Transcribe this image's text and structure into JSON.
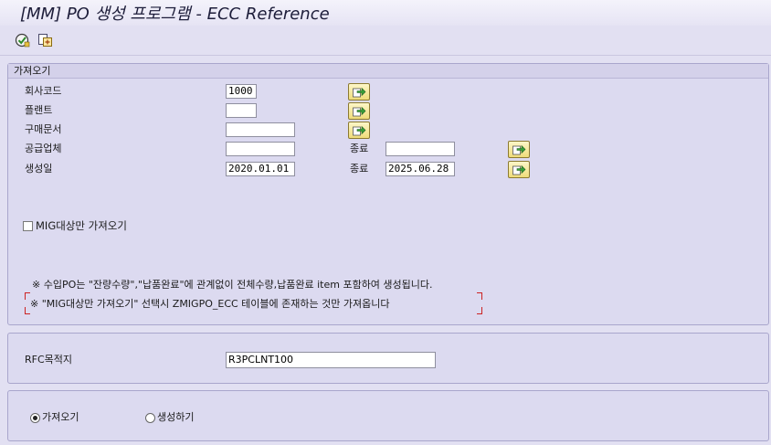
{
  "window": {
    "title": "[MM] PO 생성 프로그램 - ECC Reference"
  },
  "toolbar": {
    "execute_icon": "execute-icon",
    "variant_icon": "get-variant-icon"
  },
  "group_fetch": {
    "title": "가져오기",
    "rows": [
      {
        "label": "회사코드",
        "from_value": "1000"
      },
      {
        "label": "플랜트",
        "from_value": ""
      },
      {
        "label": "구매문서",
        "from_value": ""
      },
      {
        "label": "공급업체",
        "from_value": "",
        "to_label": "종료",
        "to_value": ""
      },
      {
        "label": "생성일",
        "from_value": "2020.01.01",
        "to_label": "종료",
        "to_value": "2025.06.28"
      }
    ],
    "mig_checkbox_label": "MIG대상만 가져오기",
    "mig_checked": false,
    "note_1": "※ 수입PO는 \"잔량수량\",\"납품완료\"에 관계없이 전체수량,납품완료 item 포함하여 생성됩니다.",
    "note_2": "※ \"MIG대상만 가져오기\" 선택시 ZMIGPO_ECC 테이블에 존재하는 것만 가져옵니다"
  },
  "group_rfc": {
    "label": "RFC목적지",
    "value": "R3PCLNT100"
  },
  "group_mode": {
    "options": [
      {
        "label": "가져오기",
        "selected": true
      },
      {
        "label": "생성하기",
        "selected": false
      }
    ]
  },
  "colors": {
    "background": "#e2e0f2",
    "group_border": "#a9a6cc",
    "selection_button": "#efdc7a",
    "note_bracket": "#cc2222"
  }
}
